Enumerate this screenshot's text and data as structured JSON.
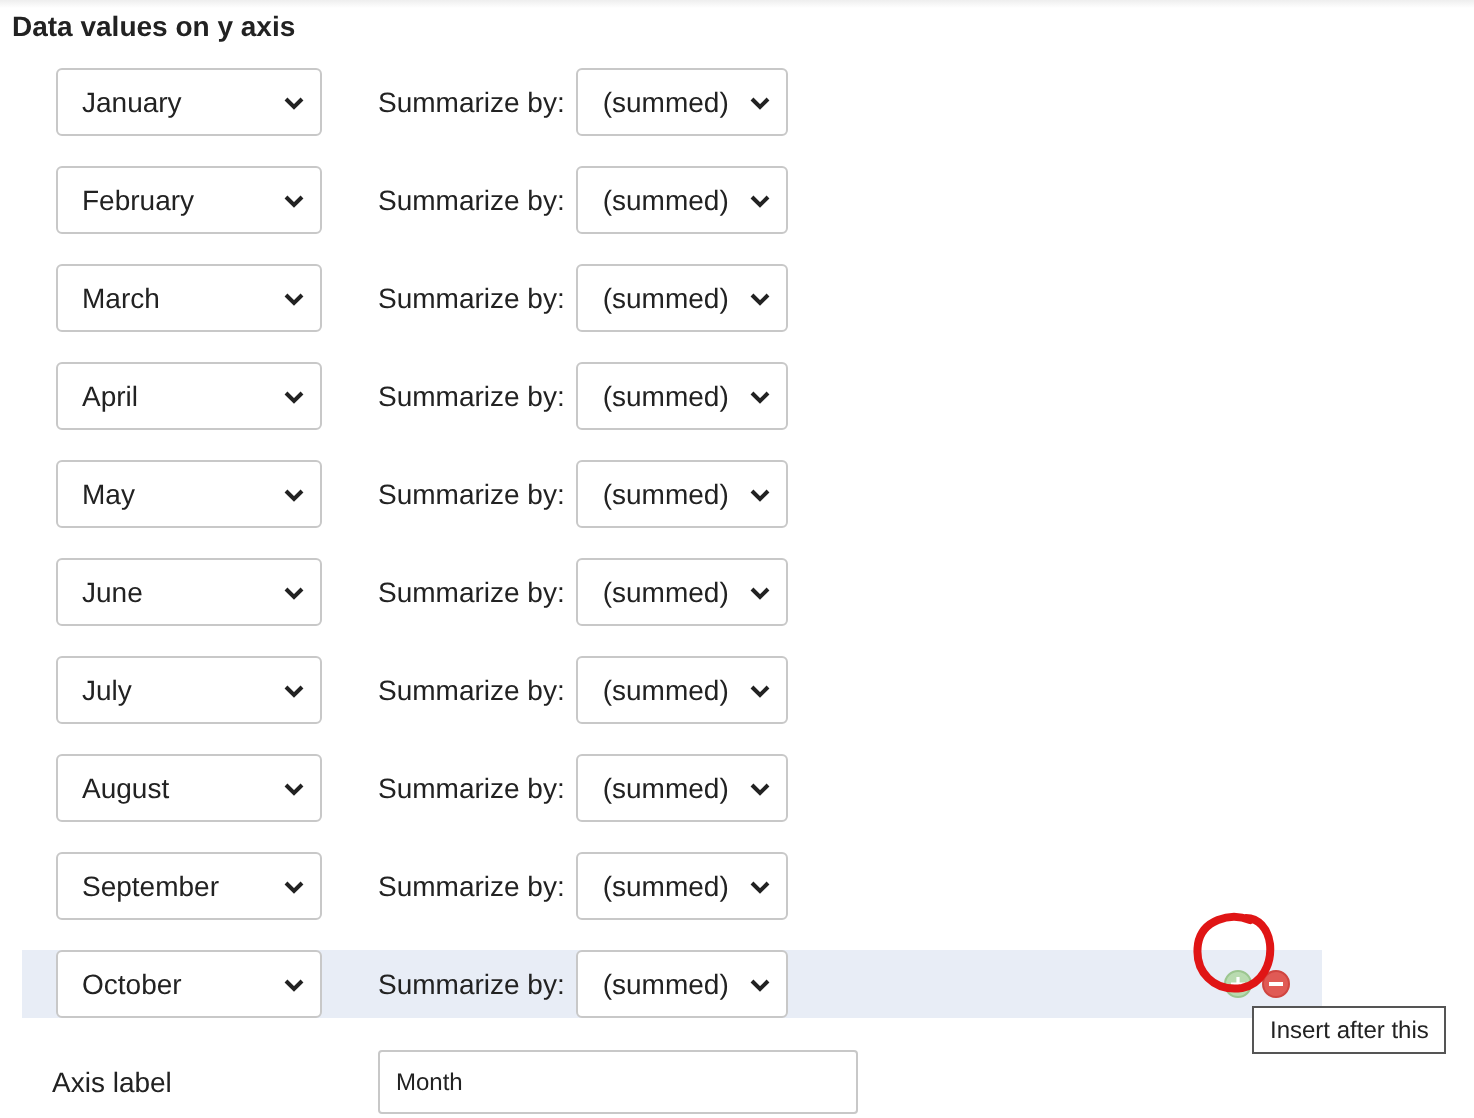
{
  "section_title": "Data values on y axis",
  "rows": [
    {
      "field": "January",
      "summarize_label": "Summarize by:",
      "summarize": "(summed)",
      "highlighted": false
    },
    {
      "field": "February",
      "summarize_label": "Summarize by:",
      "summarize": "(summed)",
      "highlighted": false
    },
    {
      "field": "March",
      "summarize_label": "Summarize by:",
      "summarize": "(summed)",
      "highlighted": false
    },
    {
      "field": "April",
      "summarize_label": "Summarize by:",
      "summarize": "(summed)",
      "highlighted": false
    },
    {
      "field": "May",
      "summarize_label": "Summarize by:",
      "summarize": "(summed)",
      "highlighted": false
    },
    {
      "field": "June",
      "summarize_label": "Summarize by:",
      "summarize": "(summed)",
      "highlighted": false
    },
    {
      "field": "July",
      "summarize_label": "Summarize by:",
      "summarize": "(summed)",
      "highlighted": false
    },
    {
      "field": "August",
      "summarize_label": "Summarize by:",
      "summarize": "(summed)",
      "highlighted": false
    },
    {
      "field": "September",
      "summarize_label": "Summarize by:",
      "summarize": "(summed)",
      "highlighted": false
    },
    {
      "field": "October",
      "summarize_label": "Summarize by:",
      "summarize": "(summed)",
      "highlighted": true
    }
  ],
  "tooltip": "Insert after this",
  "axis_label": {
    "label": "Axis label",
    "value": "Month"
  }
}
